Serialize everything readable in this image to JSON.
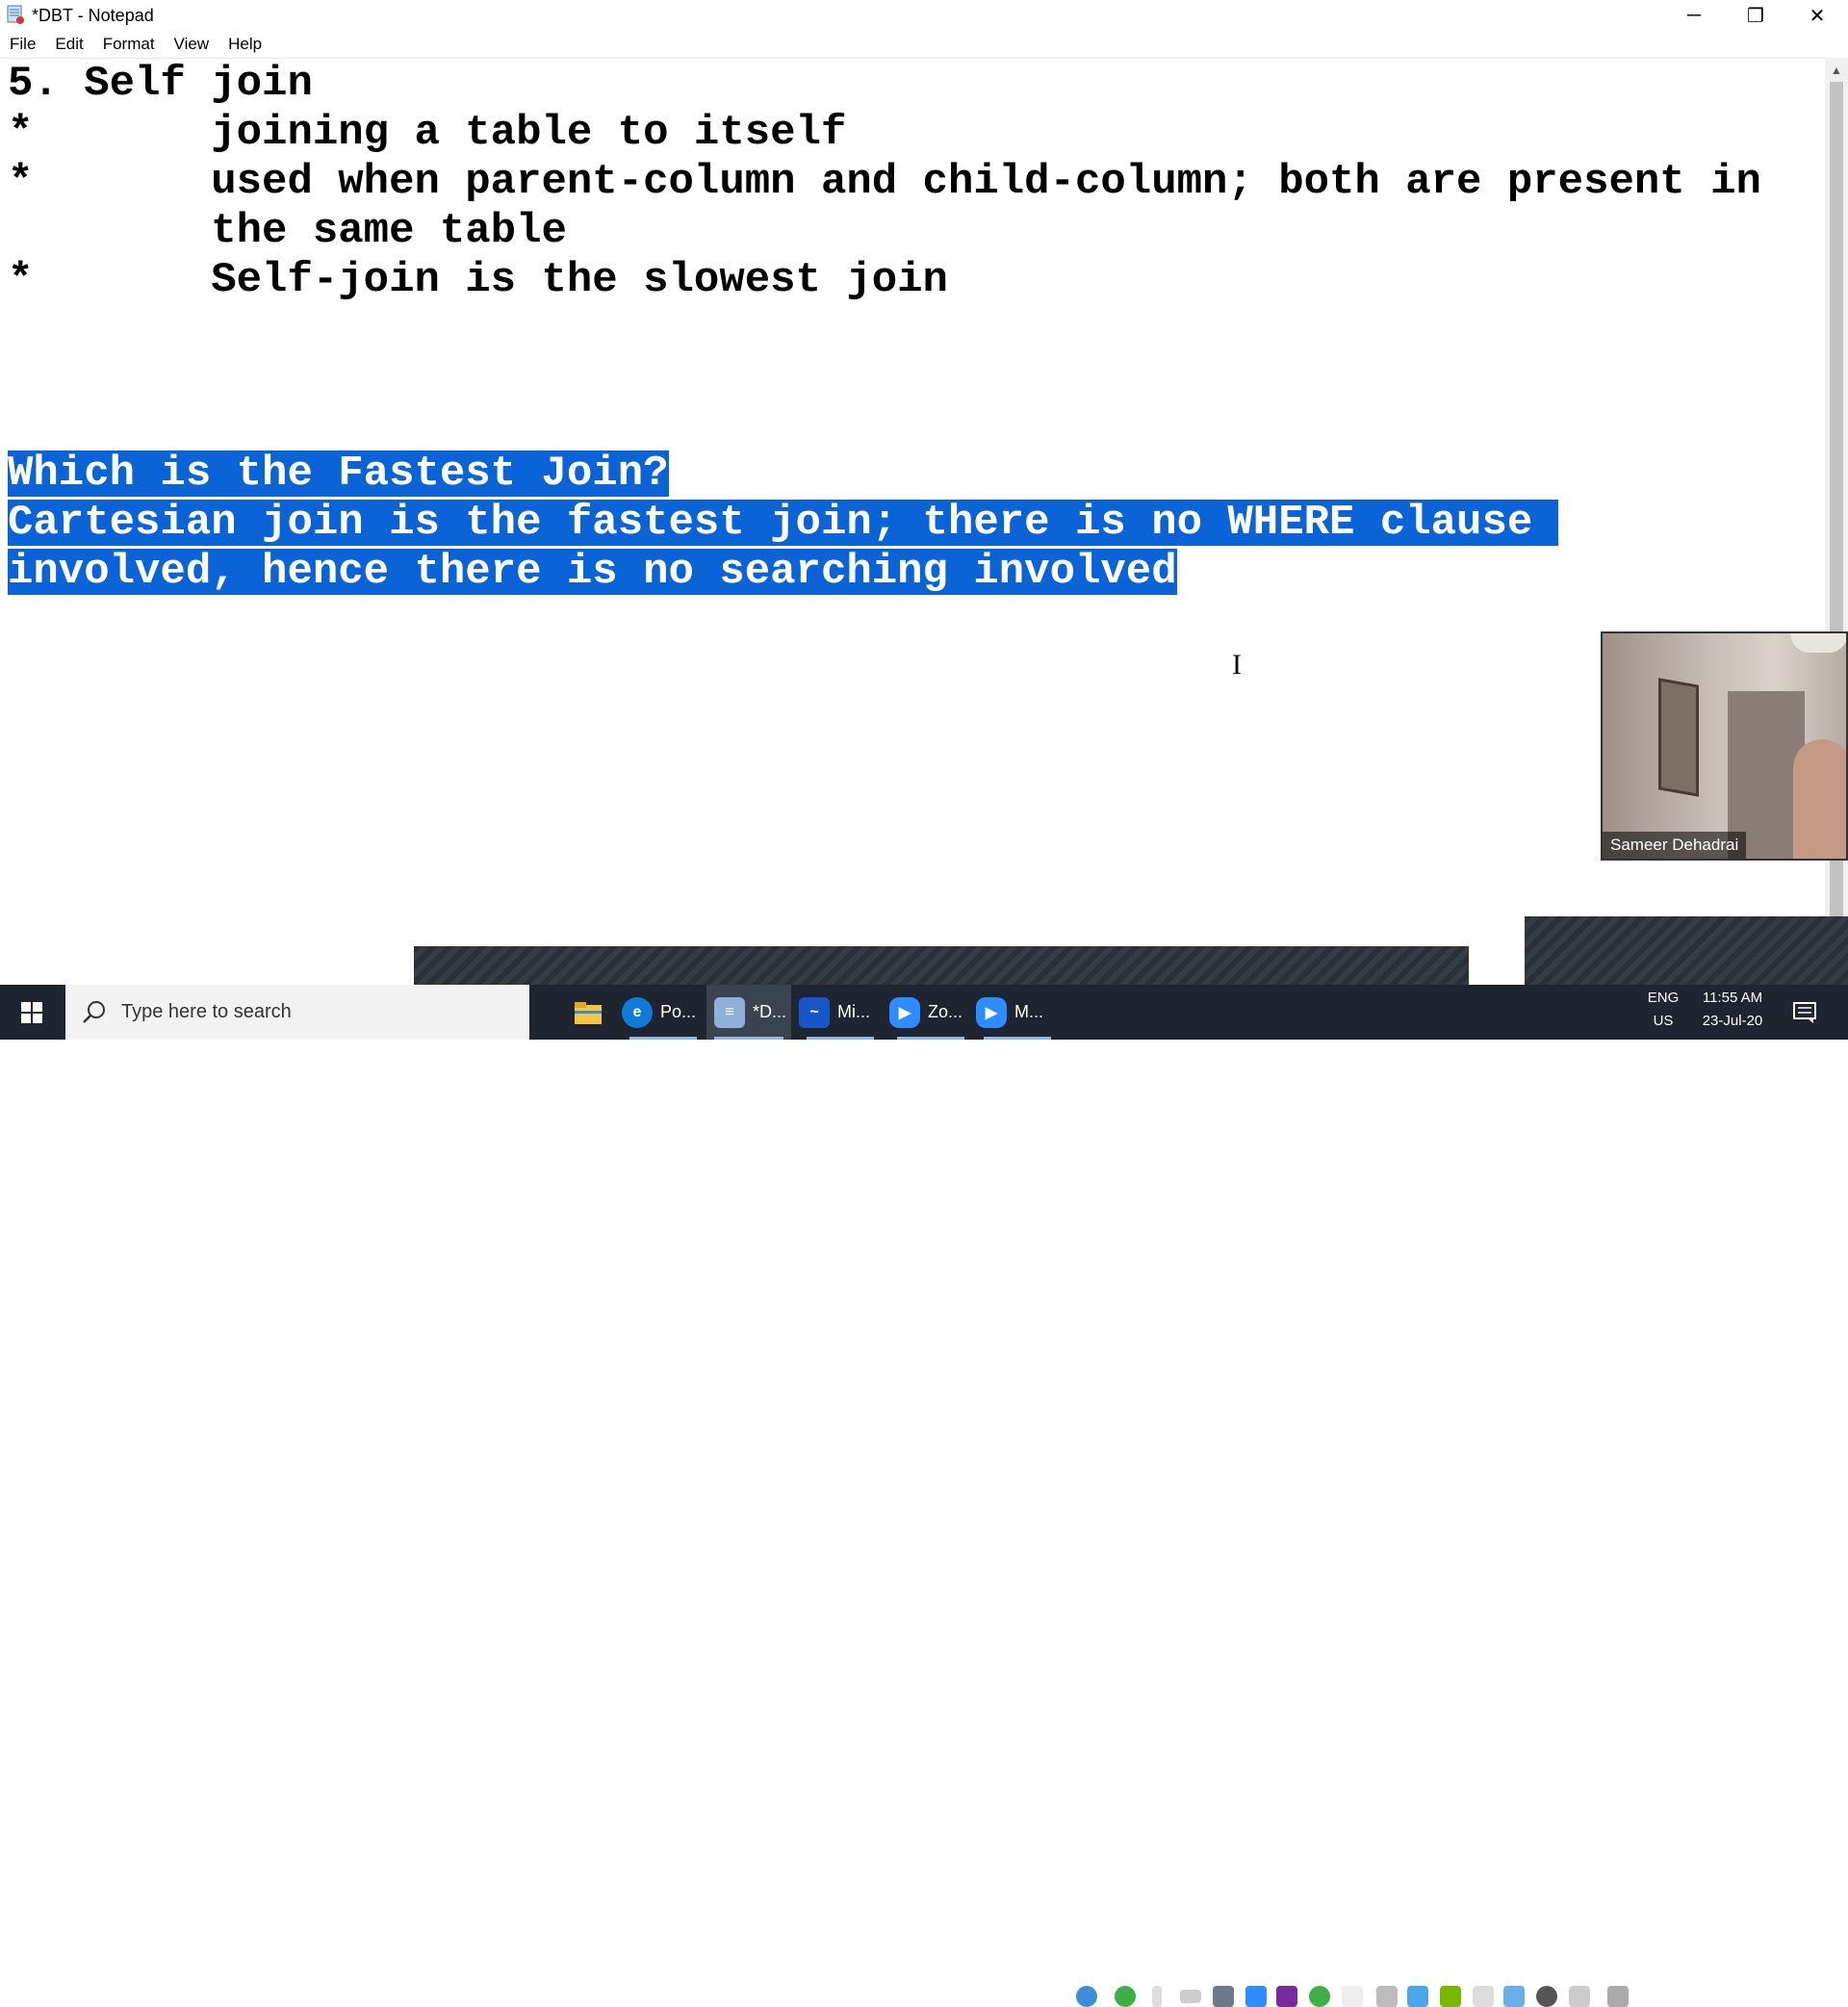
{
  "window": {
    "title": "*DBT - Notepad",
    "minimize_glyph": "─",
    "maximize_glyph": "❐",
    "close_glyph": "✕"
  },
  "menu": {
    "items": [
      "File",
      "Edit",
      "Format",
      "View",
      "Help"
    ]
  },
  "editor": {
    "lines": [
      "5. Self join",
      "*       joining a table to itself",
      "*       used when parent-column and child-column; both are present in",
      "        the same table",
      "*       Self-join is the slowest join"
    ],
    "selected_lines": [
      "Which is the Fastest Join?",
      "Cartesian join is the fastest join; there is no WHERE clause ",
      "involved, hence there is no searching involved"
    ],
    "selection_color": "#0a64d8"
  },
  "webcam": {
    "participant_name": "Sameer Dehadrai"
  },
  "taskbar": {
    "search_placeholder": "Type here to search",
    "apps": [
      {
        "label": "Po...",
        "icon": "edge-icon",
        "color": "#0f7bd6",
        "active": false
      },
      {
        "label": "*D...",
        "icon": "notepad-icon",
        "color": "#8fb0d8",
        "active": true
      },
      {
        "label": "Mi...",
        "icon": "whiteboard-icon",
        "color": "#1756c9",
        "active": false
      },
      {
        "label": "Zo...",
        "icon": "zoom-icon",
        "color": "#2d8cff",
        "active": false
      },
      {
        "label": "M...",
        "icon": "zoom-meeting-icon",
        "color": "#2d8cff",
        "active": false
      }
    ],
    "language": "ENG",
    "region": "US",
    "time": "11:55 AM",
    "date": "23-Jul-20"
  }
}
